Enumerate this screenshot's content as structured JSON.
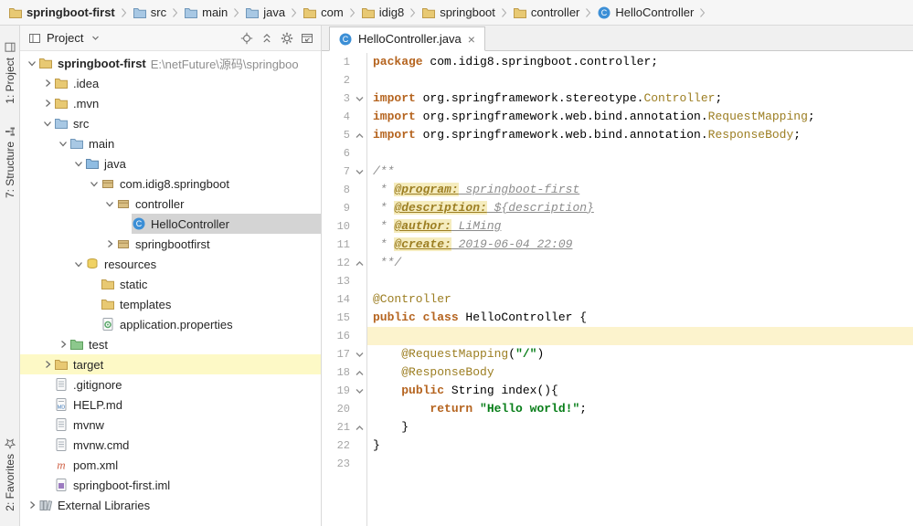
{
  "colors": {
    "keyword": "#b5641f",
    "annotation": "#9c7e22",
    "string": "#067d17",
    "comment": "#8c8c8c",
    "doctag_bg": "#f5ecbe",
    "caret_line": "#fcf3cd",
    "selection": "#d4d4d4",
    "row_highlight": "#fdf9c6"
  },
  "breadcrumb": {
    "items": [
      {
        "label": "springboot-first",
        "icon": "folder",
        "bold": true
      },
      {
        "label": "src",
        "icon": "folder-blue"
      },
      {
        "label": "main",
        "icon": "folder-blue"
      },
      {
        "label": "java",
        "icon": "folder-blue"
      },
      {
        "label": "com",
        "icon": "folder"
      },
      {
        "label": "idig8",
        "icon": "folder"
      },
      {
        "label": "springboot",
        "icon": "folder"
      },
      {
        "label": "controller",
        "icon": "folder"
      },
      {
        "label": "HelloController",
        "icon": "class"
      }
    ]
  },
  "tool_stripes": {
    "top": [
      {
        "label": "1: Project",
        "icon": "stripe-project"
      },
      {
        "label": "7: Structure",
        "icon": "stripe-structure"
      }
    ],
    "bottom": [
      {
        "label": "2: Favorites",
        "icon": "stripe-favorites"
      }
    ]
  },
  "project_panel": {
    "title": "Project",
    "header_icons": [
      "locate",
      "collapse-all",
      "settings-gear",
      "hide"
    ],
    "tree": [
      {
        "level": 0,
        "chevron": "down",
        "icon": "folder",
        "label": "springboot-first",
        "suffix": " E:\\netFuture\\源码\\springboo",
        "bold": true
      },
      {
        "level": 1,
        "chevron": "right",
        "icon": "folder",
        "label": ".idea"
      },
      {
        "level": 1,
        "chevron": "right",
        "icon": "folder",
        "label": ".mvn"
      },
      {
        "level": 1,
        "chevron": "down",
        "icon": "folder-blue",
        "label": "src"
      },
      {
        "level": 2,
        "chevron": "down",
        "icon": "folder-blue",
        "label": "main"
      },
      {
        "level": 3,
        "chevron": "down",
        "icon": "folder-java",
        "label": "java"
      },
      {
        "level": 4,
        "chevron": "down",
        "icon": "package",
        "label": "com.idig8.springboot"
      },
      {
        "level": 5,
        "chevron": "down",
        "icon": "package",
        "label": "controller"
      },
      {
        "level": 6,
        "chevron": "none",
        "icon": "class",
        "label": "HelloController",
        "selected": true
      },
      {
        "level": 5,
        "chevron": "right",
        "icon": "package",
        "label": "springbootfirst"
      },
      {
        "level": 3,
        "chevron": "down",
        "icon": "resources",
        "label": "resources"
      },
      {
        "level": 4,
        "chevron": "none",
        "icon": "folder",
        "label": "static"
      },
      {
        "level": 4,
        "chevron": "none",
        "icon": "folder",
        "label": "templates"
      },
      {
        "level": 4,
        "chevron": "none",
        "icon": "props",
        "label": "application.properties"
      },
      {
        "level": 2,
        "chevron": "right",
        "icon": "folder-test",
        "label": "test"
      },
      {
        "level": 1,
        "chevron": "right",
        "icon": "folder",
        "label": "target",
        "highlight": true
      },
      {
        "level": 1,
        "chevron": "none",
        "icon": "file",
        "label": ".gitignore"
      },
      {
        "level": 1,
        "chevron": "none",
        "icon": "md",
        "label": "HELP.md"
      },
      {
        "level": 1,
        "chevron": "none",
        "icon": "file",
        "label": "mvnw"
      },
      {
        "level": 1,
        "chevron": "none",
        "icon": "file",
        "label": "mvnw.cmd"
      },
      {
        "level": 1,
        "chevron": "none",
        "icon": "maven",
        "label": "pom.xml"
      },
      {
        "level": 1,
        "chevron": "none",
        "icon": "iml",
        "label": "springboot-first.iml"
      },
      {
        "level": 0,
        "chevron": "right",
        "icon": "libs",
        "label": "External Libraries"
      }
    ]
  },
  "editor": {
    "tab": {
      "label": "HelloController.java",
      "icon": "class",
      "close": "×"
    },
    "code": {
      "lines": [
        {
          "tokens": [
            {
              "c": "kw",
              "t": "package"
            },
            {
              "c": "pl",
              "t": " com.idig8.springboot.controller;"
            }
          ]
        },
        {
          "tokens": []
        },
        {
          "fold": "down",
          "tokens": [
            {
              "c": "kw",
              "t": "import"
            },
            {
              "c": "pl",
              "t": " org.springframework.stereotype."
            },
            {
              "c": "ann",
              "t": "Controller"
            },
            {
              "c": "pl",
              "t": ";"
            }
          ]
        },
        {
          "tokens": [
            {
              "c": "kw",
              "t": "import"
            },
            {
              "c": "pl",
              "t": " org.springframework.web.bind.annotation."
            },
            {
              "c": "ann",
              "t": "RequestMapping"
            },
            {
              "c": "pl",
              "t": ";"
            }
          ]
        },
        {
          "fold": "up",
          "tokens": [
            {
              "c": "kw",
              "t": "import"
            },
            {
              "c": "pl",
              "t": " org.springframework.web.bind.annotation."
            },
            {
              "c": "ann",
              "t": "ResponseBody"
            },
            {
              "c": "pl",
              "t": ";"
            }
          ]
        },
        {
          "tokens": []
        },
        {
          "fold": "down",
          "tokens": [
            {
              "c": "com",
              "t": "/**"
            }
          ]
        },
        {
          "tokens": [
            {
              "c": "com",
              "t": " * "
            },
            {
              "c": "doctag",
              "t": "@program:"
            },
            {
              "c": "docval",
              "t": " springboot-first"
            }
          ]
        },
        {
          "tokens": [
            {
              "c": "com",
              "t": " * "
            },
            {
              "c": "doctag",
              "t": "@description:"
            },
            {
              "c": "docval",
              "t": " ${description}"
            }
          ]
        },
        {
          "tokens": [
            {
              "c": "com",
              "t": " * "
            },
            {
              "c": "doctag",
              "t": "@author:"
            },
            {
              "c": "docval",
              "t": " LiMing"
            }
          ]
        },
        {
          "tokens": [
            {
              "c": "com",
              "t": " * "
            },
            {
              "c": "doctag",
              "t": "@create:"
            },
            {
              "c": "docval",
              "t": " 2019-06-04 22:09"
            }
          ]
        },
        {
          "fold": "up",
          "tokens": [
            {
              "c": "com",
              "t": " **/"
            }
          ]
        },
        {
          "tokens": []
        },
        {
          "tokens": [
            {
              "c": "ann",
              "t": "@Controller"
            }
          ]
        },
        {
          "tokens": [
            {
              "c": "kw",
              "t": "public class"
            },
            {
              "c": "pl",
              "t": " HelloController {"
            }
          ]
        },
        {
          "caret": true,
          "tokens": []
        },
        {
          "fold": "down",
          "tokens": [
            {
              "c": "pl",
              "t": "    "
            },
            {
              "c": "ann",
              "t": "@RequestMapping"
            },
            {
              "c": "pl",
              "t": "("
            },
            {
              "c": "str",
              "t": "\"/\""
            },
            {
              "c": "pl",
              "t": ")"
            }
          ]
        },
        {
          "fold": "up",
          "tokens": [
            {
              "c": "pl",
              "t": "    "
            },
            {
              "c": "ann",
              "t": "@ResponseBody"
            }
          ]
        },
        {
          "fold": "down",
          "tokens": [
            {
              "c": "pl",
              "t": "    "
            },
            {
              "c": "kw",
              "t": "public"
            },
            {
              "c": "pl",
              "t": " String index(){"
            }
          ]
        },
        {
          "tokens": [
            {
              "c": "pl",
              "t": "        "
            },
            {
              "c": "kw",
              "t": "return"
            },
            {
              "c": "pl",
              "t": " "
            },
            {
              "c": "str",
              "t": "\"Hello world!\""
            },
            {
              "c": "pl",
              "t": ";"
            }
          ]
        },
        {
          "fold": "up",
          "tokens": [
            {
              "c": "pl",
              "t": "    }"
            }
          ]
        },
        {
          "tokens": [
            {
              "c": "pl",
              "t": "}"
            }
          ]
        },
        {
          "tokens": []
        }
      ]
    }
  }
}
